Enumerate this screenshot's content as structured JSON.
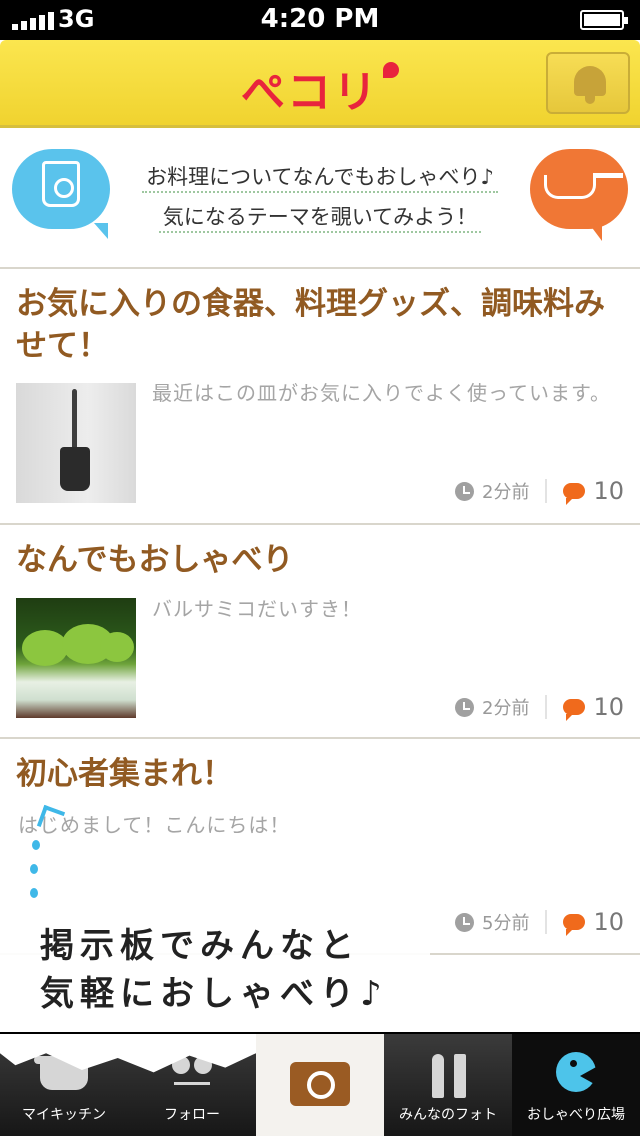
{
  "status_bar": {
    "carrier": "3G",
    "time": "4:20 PM"
  },
  "header": {
    "logo": "ぺコリ",
    "bell_icon": "bell-icon"
  },
  "banner": {
    "line1": "お料理についてなんでもおしゃべり♪",
    "line2": "気になるテーマを覗いてみよう！",
    "left_icon": "kitchen-scale-icon",
    "right_icon": "cooking-pot-icon"
  },
  "threads": [
    {
      "title": "お気に入りの食器、料理グッズ、調味料みせて！",
      "excerpt": "最近はこの皿がお気に入りでよく使っています。",
      "time": "2分前",
      "comments": "10",
      "thumbnail": "spatula-photo"
    },
    {
      "title": "なんでもおしゃべり",
      "excerpt": "バルサミコだいすき！",
      "time": "2分前",
      "comments": "10",
      "thumbnail": "greens-photo"
    },
    {
      "title": "初心者集まれ！",
      "excerpt": "はじめまして！こんにちは！",
      "time": "5分前",
      "comments": "10",
      "thumbnail": ""
    }
  ],
  "tutorial": {
    "line1": "掲示板でみんなと",
    "line2": "気軽におしゃべり♪"
  },
  "tab_bar": {
    "tabs": [
      {
        "label": "マイキッチン",
        "icon": "pot-icon"
      },
      {
        "label": "フォロー",
        "icon": "follow-icon"
      },
      {
        "label": "",
        "icon": "camera-icon"
      },
      {
        "label": "みんなのフォト",
        "icon": "fork-spoon-icon"
      },
      {
        "label": "おしゃべり広場",
        "icon": "pacman-icon",
        "selected": true
      }
    ]
  },
  "colors": {
    "header": "#f6dc3e",
    "title": "#915a22",
    "accent": "#f06a1c",
    "logo": "#e8243d",
    "cloud_blue": "#5ac3ec",
    "cloud_orange": "#f07735"
  }
}
